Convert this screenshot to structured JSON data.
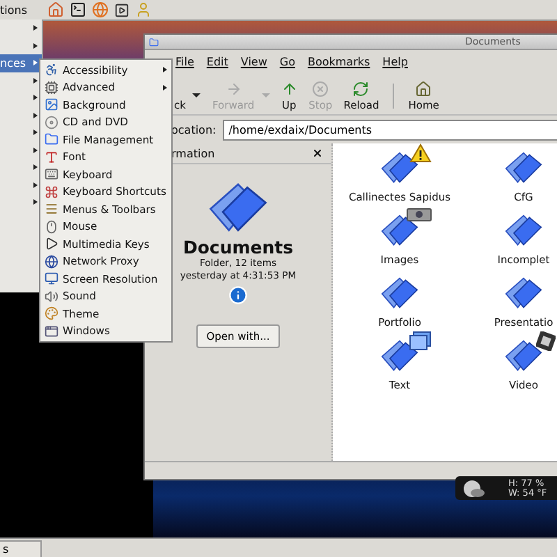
{
  "top_panel": {
    "menu_label": "tions"
  },
  "applications_menu": {
    "items": [
      {
        "has_submenu": true,
        "selected": false
      },
      {
        "has_submenu": true,
        "selected": false
      },
      {
        "label": "nces",
        "has_submenu": true,
        "selected": true
      },
      {
        "has_submenu": true,
        "selected": false
      },
      {
        "has_submenu": true,
        "selected": false
      },
      {
        "has_submenu": true,
        "selected": false
      },
      {
        "has_submenu": true,
        "selected": false
      },
      {
        "has_submenu": true,
        "selected": false
      },
      {
        "has_submenu": true,
        "selected": false
      },
      {
        "has_submenu": true,
        "selected": false
      },
      {
        "has_submenu": true,
        "selected": false
      }
    ]
  },
  "preferences_submenu": {
    "items": [
      {
        "label": "Accessibility",
        "has_submenu": true
      },
      {
        "label": "Advanced",
        "has_submenu": true
      },
      {
        "label": "Background",
        "has_submenu": false
      },
      {
        "label": "CD and DVD",
        "has_submenu": false
      },
      {
        "label": "File Management",
        "has_submenu": false
      },
      {
        "label": "Font",
        "has_submenu": false
      },
      {
        "label": "Keyboard",
        "has_submenu": false
      },
      {
        "label": "Keyboard Shortcuts",
        "has_submenu": false
      },
      {
        "label": "Menus & Toolbars",
        "has_submenu": false
      },
      {
        "label": "Mouse",
        "has_submenu": false
      },
      {
        "label": "Multimedia Keys",
        "has_submenu": false
      },
      {
        "label": "Network Proxy",
        "has_submenu": false
      },
      {
        "label": "Screen Resolution",
        "has_submenu": false
      },
      {
        "label": "Sound",
        "has_submenu": false
      },
      {
        "label": "Theme",
        "has_submenu": false
      },
      {
        "label": "Windows",
        "has_submenu": false
      }
    ]
  },
  "window": {
    "title": "Documents",
    "menu": [
      "File",
      "Edit",
      "View",
      "Go",
      "Bookmarks",
      "Help"
    ],
    "toolbar": [
      {
        "kind": "back",
        "label": "ck",
        "disabled": false,
        "dropdown": true
      },
      {
        "kind": "forward",
        "label": "Forward",
        "disabled": true,
        "dropdown": true
      },
      {
        "kind": "up",
        "label": "Up",
        "disabled": false,
        "dropdown": false
      },
      {
        "kind": "stop",
        "label": "Stop",
        "disabled": true,
        "dropdown": false
      },
      {
        "kind": "reload",
        "label": "Reload",
        "disabled": false,
        "dropdown": false
      },
      {
        "kind": "separator"
      },
      {
        "kind": "home",
        "label": "Home",
        "disabled": false,
        "dropdown": false
      }
    ],
    "location": {
      "label": "ocation:",
      "value": "/home/exdaix/Documents"
    },
    "sidebar": {
      "title": "rmation",
      "name": "Documents",
      "details": [
        "Folder, 12 items",
        "yesterday at 4:31:53 PM"
      ],
      "button": "Open with..."
    },
    "files": [
      {
        "name": "Callinectes Sapidus",
        "kind": "warning"
      },
      {
        "name": "CfG",
        "kind": "plain"
      },
      {
        "name": "Images",
        "kind": "camera"
      },
      {
        "name": "Incomplet",
        "kind": "plain"
      },
      {
        "name": "Portfolio",
        "kind": "plain"
      },
      {
        "name": "Presentatio",
        "kind": "plain"
      },
      {
        "name": "Text",
        "kind": "pages"
      },
      {
        "name": "Video",
        "kind": "film"
      }
    ]
  },
  "weather": {
    "lines": [
      "H: 77 %",
      "W: 54 °F"
    ]
  },
  "taskbar": {
    "buttons": [
      "s"
    ]
  }
}
